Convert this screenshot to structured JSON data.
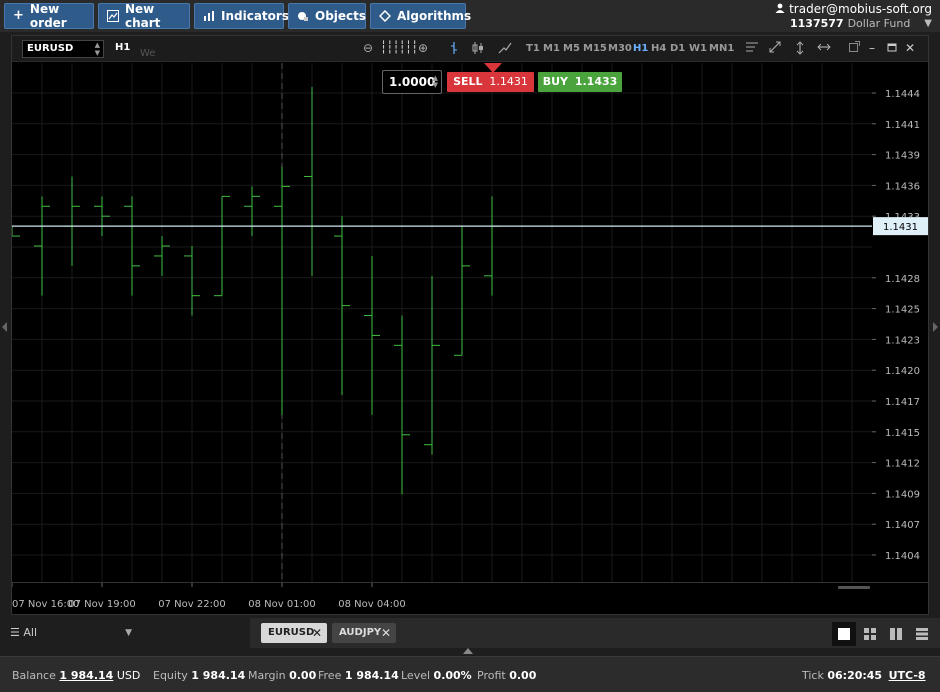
{
  "toolbar": {
    "new_order": "New order",
    "new_chart": "New chart",
    "indicators": "Indicators",
    "objects": "Objects",
    "algorithms": "Algorithms"
  },
  "user": {
    "email": "trader@mobius-soft.org",
    "account": "1137577",
    "fund": "Dollar Fund"
  },
  "chart": {
    "symbol": "EURUSD",
    "timeframe": "H1",
    "timeframes": [
      "T1",
      "M1",
      "M5",
      "M15",
      "M30",
      "H1",
      "H4",
      "D1",
      "W1",
      "MN1"
    ],
    "active_timeframe": "H1",
    "watermark": "We",
    "quantity": "1.0000",
    "sell_label": "SELL",
    "sell_price": "1.1431",
    "buy_label": "BUY",
    "buy_price": "1.1433",
    "current_price_label": "1.1431",
    "colors": {
      "bar": "#3fbf3f",
      "priceline": "#cfe8f5",
      "sell": "#d9363b",
      "buy": "#4aa33c"
    }
  },
  "chart_data": {
    "type": "ohlc",
    "price_ticks": [
      "1.1444",
      "1.1441",
      "1.1439",
      "1.1436",
      "1.1433",
      "1.1431",
      "1.1428",
      "1.1425",
      "1.1423",
      "1.1420",
      "1.1417",
      "1.1415",
      "1.1412",
      "1.1409",
      "1.1407",
      "1.1404"
    ],
    "time_ticks": [
      "07 Nov 16:00",
      "07 Nov 19:00",
      "07 Nov 22:00",
      "08 Nov 01:00",
      "08 Nov 04:00"
    ],
    "bars": [
      {
        "o": 1.1431,
        "h": 1.1431,
        "l": 1.143,
        "c": 1.143
      },
      {
        "o": 1.1429,
        "h": 1.1434,
        "l": 1.1424,
        "c": 1.1433
      },
      {
        "o": 1.1431,
        "h": 1.1436,
        "l": 1.1427,
        "c": 1.1433
      },
      {
        "o": 1.1433,
        "h": 1.1434,
        "l": 1.143,
        "c": 1.1432
      },
      {
        "o": 1.1433,
        "h": 1.1434,
        "l": 1.1424,
        "c": 1.1427
      },
      {
        "o": 1.1428,
        "h": 1.143,
        "l": 1.1426,
        "c": 1.1429
      },
      {
        "o": 1.1428,
        "h": 1.1429,
        "l": 1.1422,
        "c": 1.1424
      },
      {
        "o": 1.1424,
        "h": 1.1434,
        "l": 1.1424,
        "c": 1.1434
      },
      {
        "o": 1.1433,
        "h": 1.1435,
        "l": 1.143,
        "c": 1.1434
      },
      {
        "o": 1.1433,
        "h": 1.1437,
        "l": 1.1412,
        "c": 1.1435
      },
      {
        "o": 1.1436,
        "h": 1.1445,
        "l": 1.1426,
        "c": 1.1431
      },
      {
        "o": 1.143,
        "h": 1.1432,
        "l": 1.1414,
        "c": 1.1423
      },
      {
        "o": 1.1422,
        "h": 1.1428,
        "l": 1.1412,
        "c": 1.142
      },
      {
        "o": 1.1419,
        "h": 1.1422,
        "l": 1.1404,
        "c": 1.141
      },
      {
        "o": 1.1409,
        "h": 1.1426,
        "l": 1.1408,
        "c": 1.1419
      },
      {
        "o": 1.1418,
        "h": 1.1431,
        "l": 1.1418,
        "c": 1.1427
      },
      {
        "o": 1.1426,
        "h": 1.1434,
        "l": 1.1424,
        "c": 1.1431
      }
    ],
    "current_price": 1.1431,
    "ylim": [
      1.14,
      1.1448
    ]
  },
  "tabs": {
    "filter_label": "All",
    "symbols": [
      "EURUSD",
      "AUDJPY"
    ]
  },
  "status": {
    "balance_label": "Balance",
    "balance_value": "1 984.14",
    "balance_ccy": "USD",
    "equity_label": "Equity",
    "equity_value": "1 984.14",
    "margin_label": "Margin",
    "margin_value": "0.00",
    "free_label": "Free",
    "free_value": "1 984.14",
    "level_label": "Level",
    "level_value": "0.00%",
    "profit_label": "Profit",
    "profit_value": "0.00",
    "tick_label": "Tick",
    "tick_value": "06:20:45",
    "tz": "UTC-8"
  }
}
